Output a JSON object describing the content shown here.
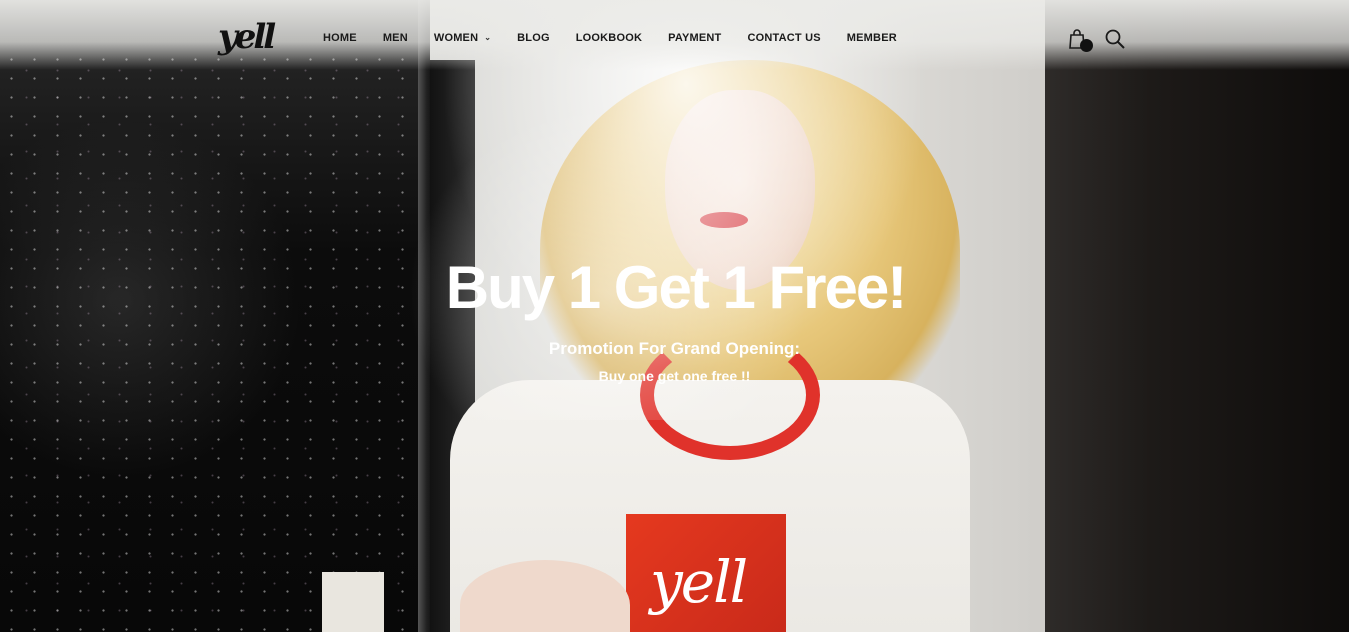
{
  "header": {
    "logo_text": "yell",
    "nav": [
      {
        "label": "HOME"
      },
      {
        "label": "MEN"
      },
      {
        "label": "WOMEN",
        "has_dropdown": true
      },
      {
        "label": "BLOG"
      },
      {
        "label": "LOOKBOOK"
      },
      {
        "label": "PAYMENT"
      },
      {
        "label": "CONTACT US"
      },
      {
        "label": "MEMBER"
      }
    ],
    "icons": {
      "cart": "shopping-bag-icon",
      "search": "search-icon"
    }
  },
  "banner": {
    "headline": "Buy 1 Get 1 Free!",
    "subtitle": "Promotion For Grand Opening:",
    "tagline": "Buy one get one free !!"
  },
  "hero_image": {
    "shirt_print_text": "yell"
  },
  "colors": {
    "nav_text": "#1a1a1a",
    "banner_text": "#ffffff",
    "accent_red": "#e0322b"
  }
}
